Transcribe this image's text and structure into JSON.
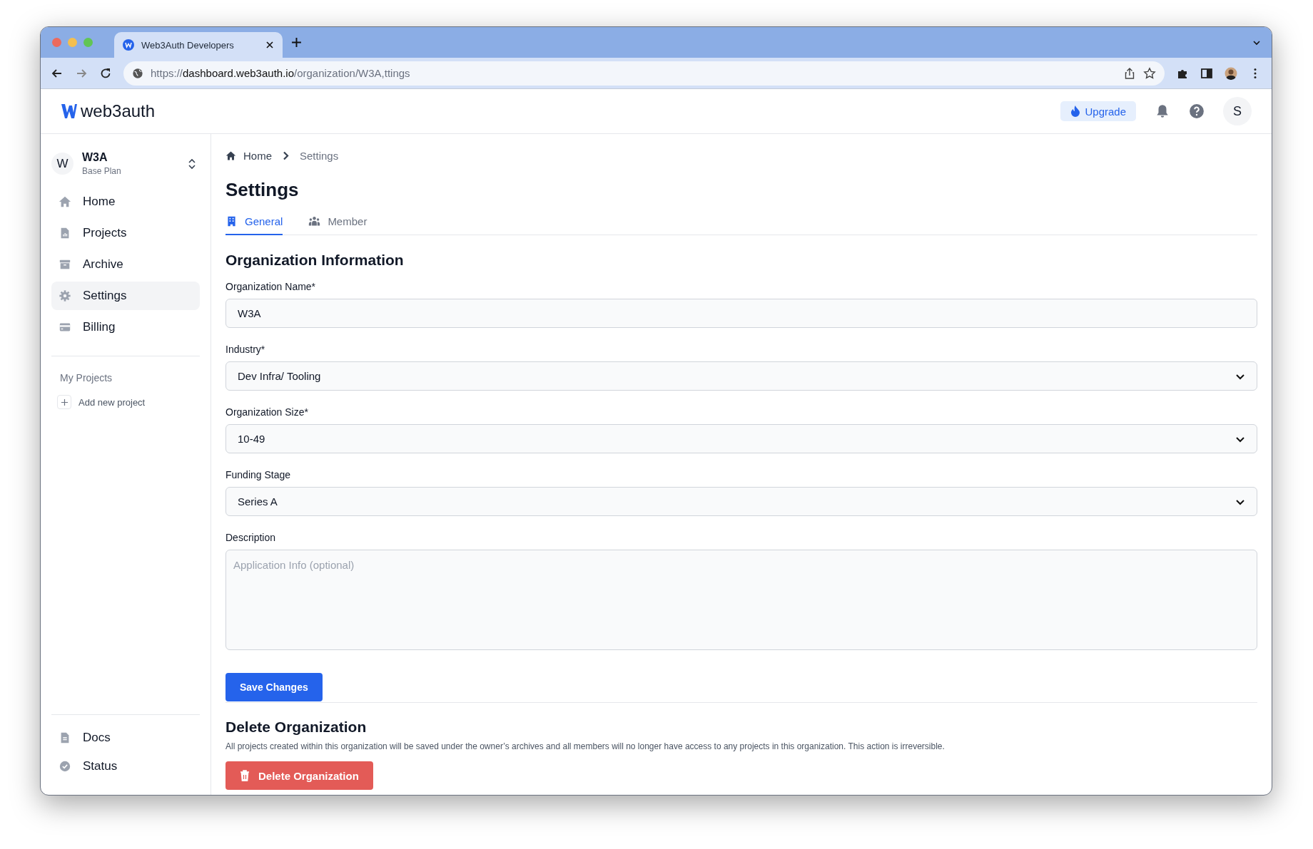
{
  "browser": {
    "tab_title": "Web3Auth Developers",
    "url_scheme": "https://",
    "url_host": "dashboard.web3auth.io",
    "url_path": "/organization/W3A,ttings"
  },
  "header": {
    "logo": "web3auth",
    "upgrade": "Upgrade",
    "avatar": "S"
  },
  "sidebar": {
    "org": {
      "initial": "W",
      "name": "W3A",
      "plan": "Base Plan"
    },
    "nav": [
      {
        "kind": "home",
        "label": "Home",
        "selected": false
      },
      {
        "kind": "projects",
        "label": "Projects",
        "selected": false
      },
      {
        "kind": "archive",
        "label": "Archive",
        "selected": false
      },
      {
        "kind": "settings",
        "label": "Settings",
        "selected": true
      },
      {
        "kind": "billing",
        "label": "Billing",
        "selected": false
      }
    ],
    "section": "My Projects",
    "add_project": "Add new project",
    "footer": [
      {
        "kind": "docs",
        "label": "Docs"
      },
      {
        "kind": "status",
        "label": "Status"
      }
    ]
  },
  "breadcrumb": [
    "Home",
    "Settings"
  ],
  "title": "Settings",
  "tabs": [
    {
      "kind": "building",
      "label": "General",
      "selected": true
    },
    {
      "kind": "people",
      "label": "Member",
      "selected": false
    }
  ],
  "section_title": "Organization Information",
  "fields": [
    {
      "kind": "text",
      "label": "Organization Name*",
      "value": "W3A"
    },
    {
      "kind": "select",
      "label": "Industry*",
      "value": "Dev Infra/ Tooling"
    },
    {
      "kind": "select",
      "label": "Organization Size*",
      "value": "10-49"
    },
    {
      "kind": "select",
      "label": "Funding Stage",
      "value": "Series A"
    },
    {
      "kind": "textarea",
      "label": "Description",
      "placeholder": "Application Info (optional)"
    }
  ],
  "save_button": "Save Changes",
  "delete": {
    "title": "Delete Organization",
    "text": "All projects created within this organization will be saved under the owner’s archives and all members will no longer have access to any projects in this organization. This action is irreversible.",
    "button": "Delete Organization"
  }
}
